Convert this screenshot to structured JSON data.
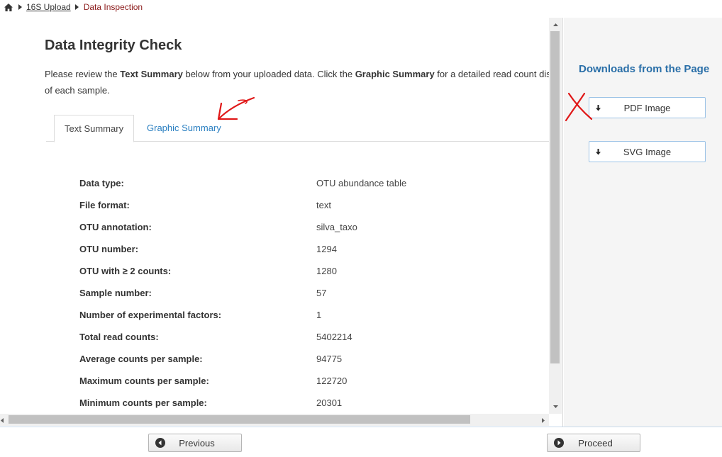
{
  "breadcrumb": {
    "home_icon": "home-icon",
    "link": "16S Upload",
    "current": "Data Inspection"
  },
  "main": {
    "title": "Data Integrity Check",
    "intro": {
      "part1": "Please review the ",
      "bold1": "Text Summary",
      "part2": " below from your uploaded data. Click the ",
      "bold2": "Graphic Summary",
      "part3": " for a detailed read count distribution of each sample."
    },
    "tabs": [
      {
        "label": "Text Summary",
        "active": true
      },
      {
        "label": "Graphic Summary",
        "active": false
      }
    ],
    "summary": [
      {
        "label": "Data type:",
        "value": "OTU abundance table"
      },
      {
        "label": "File format:",
        "value": "text"
      },
      {
        "label": "OTU annotation:",
        "value": "silva_taxo"
      },
      {
        "label": "OTU number:",
        "value": "1294"
      },
      {
        "label": "OTU with ≥ 2 counts:",
        "value": "1280"
      },
      {
        "label": "Sample number:",
        "value": "57"
      },
      {
        "label": "Number of experimental factors:",
        "value": "1"
      },
      {
        "label": "Total read counts:",
        "value": "5402214"
      },
      {
        "label": "Average counts per sample:",
        "value": "94775"
      },
      {
        "label": "Maximum counts per sample:",
        "value": "122720"
      },
      {
        "label": "Minimum counts per sample:",
        "value": "20301"
      }
    ]
  },
  "right_panel": {
    "title": "Downloads from the Page",
    "buttons": [
      {
        "label": "PDF Image",
        "icon": "download-icon"
      },
      {
        "label": "SVG Image",
        "icon": "download-icon"
      }
    ]
  },
  "footer": {
    "previous_label": "Previous",
    "proceed_label": "Proceed"
  },
  "colors": {
    "link_blue": "#2a7fc1",
    "panel_title_blue": "#2a6fa8",
    "breadcrumb_current": "#8b1a1a",
    "annotation_red": "#e01818"
  }
}
